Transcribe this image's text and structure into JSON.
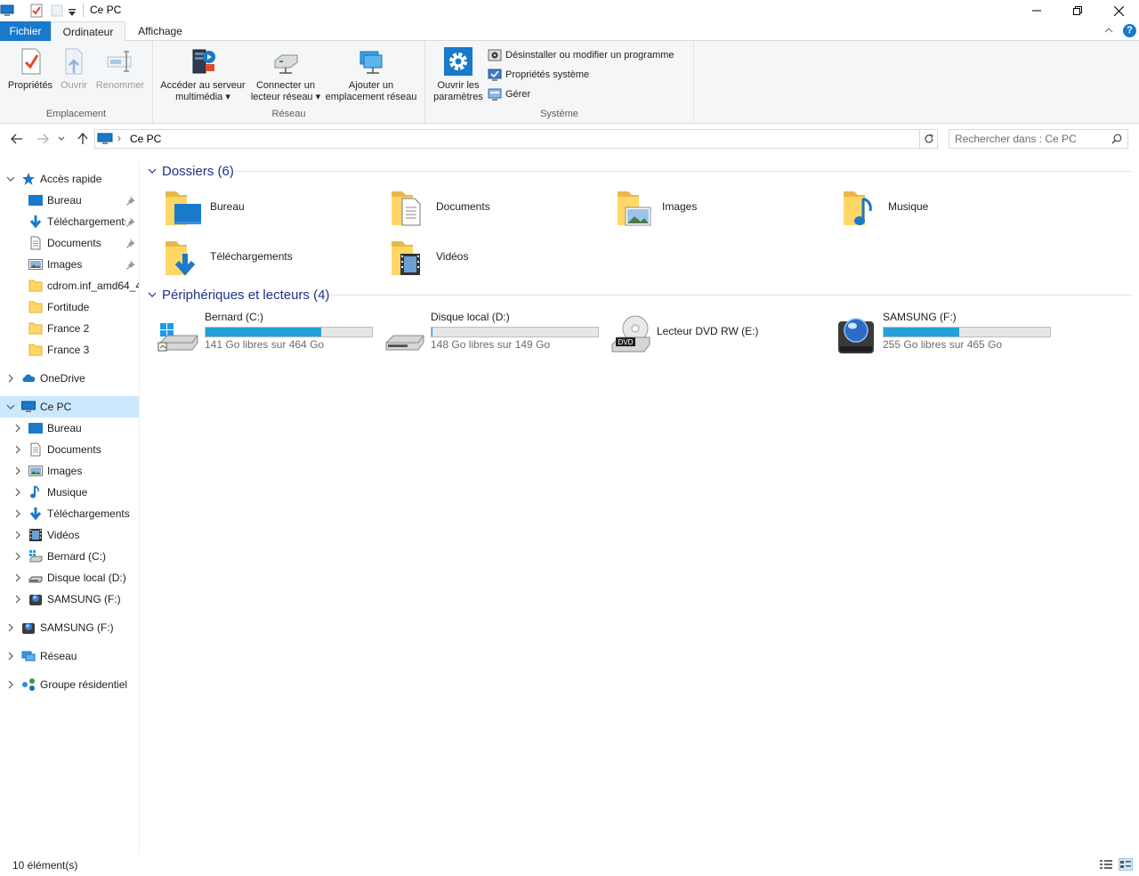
{
  "window": {
    "title": "Ce PC"
  },
  "ribbon": {
    "tabs": {
      "file": "Fichier",
      "computer": "Ordinateur",
      "view": "Affichage"
    },
    "groups": {
      "emplacement": "Emplacement",
      "reseau": "Réseau",
      "systeme": "Système"
    },
    "buttons": {
      "proprietes": "Propriétés",
      "ouvrir": "Ouvrir",
      "renommer": "Renommer",
      "media_line1": "Accéder au serveur",
      "media_line2": "multimédia",
      "connect_line1": "Connecter un",
      "connect_line2": "lecteur réseau",
      "add_line1": "Ajouter un",
      "add_line2": "emplacement réseau",
      "settings_line1": "Ouvrir les",
      "settings_line2": "paramètres"
    },
    "system_items": {
      "uninstall": "Désinstaller ou modifier un programme",
      "sysprops": "Propriétés système",
      "manage": "Gérer"
    }
  },
  "address": {
    "location": "Ce PC"
  },
  "search": {
    "placeholder": "Rechercher dans : Ce PC"
  },
  "navpane": {
    "quick_access": "Accès rapide",
    "quick_items": [
      "Bureau",
      "Téléchargements",
      "Documents",
      "Images",
      "cdrom.inf_amd64_4",
      "Fortitude",
      "France 2",
      "France 3"
    ],
    "onedrive": "OneDrive",
    "this_pc": "Ce PC",
    "pc_items": [
      "Bureau",
      "Documents",
      "Images",
      "Musique",
      "Téléchargements",
      "Vidéos",
      "Bernard (C:)",
      "Disque local (D:)",
      "SAMSUNG (F:)"
    ],
    "samsung": "SAMSUNG (F:)",
    "network": "Réseau",
    "homegroup": "Groupe résidentiel"
  },
  "content": {
    "folders_header": "Dossiers (6)",
    "folders": [
      "Bureau",
      "Documents",
      "Images",
      "Musique",
      "Téléchargements",
      "Vidéos"
    ],
    "devices_header": "Périphériques et lecteurs (4)",
    "drives": [
      {
        "name": "Bernard (C:)",
        "free": "141 Go libres sur 464 Go",
        "used_fraction": 0.696
      },
      {
        "name": "Disque local (D:)",
        "free": "148 Go libres sur 149 Go",
        "used_fraction": 0.007
      },
      {
        "name": "Lecteur DVD RW (E:)"
      },
      {
        "name": "SAMSUNG (F:)",
        "free": "255 Go libres sur 465 Go",
        "used_fraction": 0.452
      }
    ]
  },
  "status": {
    "count": "10 élément(s)"
  },
  "colors": {
    "accent": "#1979ca",
    "bar_fill": "#26a0da",
    "selected": "#cce8ff",
    "group_header": "#1e3287"
  }
}
